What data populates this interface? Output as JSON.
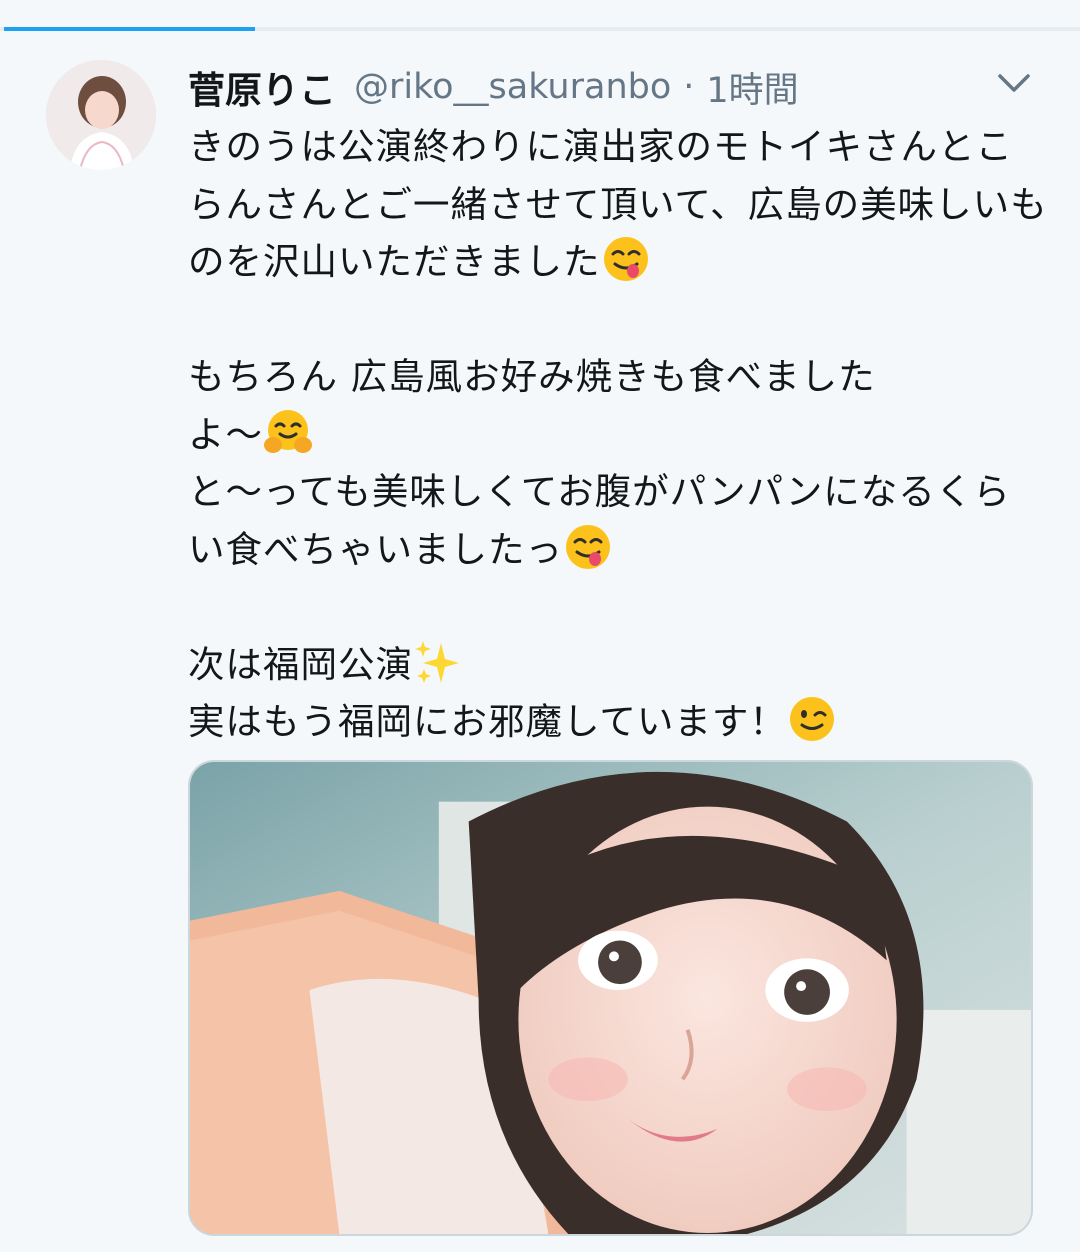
{
  "tabs": {
    "active_index": 0
  },
  "tweet": {
    "display_name": "菅原りこ",
    "handle": "@riko__sakuranbo",
    "separator": "·",
    "time": "1時間",
    "text": {
      "p1": "きのうは公演終わりに演出家のモトイキさんとこらんさんとご一緒させて頂いて、広島の美味しいものを沢山いただきました",
      "p2a": "もちろん 広島風お好み焼きも食べました\nよ〜",
      "p2b": "と〜っても美味しくてお腹がパンパンになるくらい食べちゃいましたっ",
      "p3a": "次は福岡公演",
      "p3b": "実はもう福岡にお邪魔しています！"
    },
    "emojis": [
      "face-savoring-food-icon",
      "hugging-face-icon",
      "face-savoring-food-icon",
      "sparkles-icon",
      "winking-face-icon"
    ]
  },
  "colors": {
    "accent": "#1da1f2",
    "background": "#f5f8fa",
    "secondary_text": "#657786"
  }
}
